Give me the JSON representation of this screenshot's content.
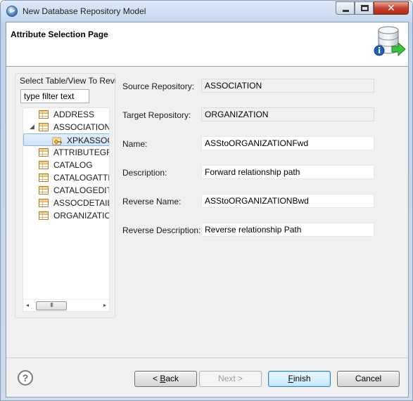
{
  "window": {
    "title": "New Database Repository Model",
    "close_glyph": "✕"
  },
  "banner": {
    "page_title": "Attribute Selection Page",
    "icon": "database-info-arrow-icon"
  },
  "tree_panel": {
    "group_label": "Select Table/View To Revi",
    "filter_placeholder": "type filter text",
    "items": [
      {
        "label": "ADDRESS",
        "type": "table"
      },
      {
        "label": "ASSOCIATION",
        "type": "table",
        "expanded": true
      },
      {
        "label": "XPKASSOCI",
        "type": "key",
        "selected": true
      },
      {
        "label": "ATTRIBUTEGRO",
        "type": "table"
      },
      {
        "label": "CATALOG",
        "type": "table"
      },
      {
        "label": "CATALOGATTF",
        "type": "table"
      },
      {
        "label": "CATALOGEDITI",
        "type": "table"
      },
      {
        "label": "ASSOCDETAIL",
        "type": "table"
      },
      {
        "label": "ORGANIZATIOI",
        "type": "table"
      }
    ],
    "expand_glyph": "◢",
    "scroll_left": "◂",
    "scroll_right": "▸",
    "scroll_thumb": "III"
  },
  "form": {
    "source_repository": {
      "label": "Source Repository:",
      "value": "ASSOCIATION"
    },
    "target_repository": {
      "label": "Target Repository:",
      "value": "ORGANIZATION"
    },
    "name": {
      "label": "Name:",
      "value": "ASStoORGANIZATIONFwd"
    },
    "description": {
      "label": "Description:",
      "value": "Forward relationship path"
    },
    "reverse_name": {
      "label": "Reverse Name:",
      "value": "ASStoORGANIZATIONBwd"
    },
    "reverse_description": {
      "label": "Reverse Description:",
      "value": "Reverse relationship Path"
    }
  },
  "buttons": {
    "help": "?",
    "back_prefix": "< ",
    "back_mnemonic": "B",
    "back_rest": "ack",
    "next": "Next >",
    "finish_mnemonic": "F",
    "finish_rest": "inish",
    "cancel": "Cancel"
  }
}
